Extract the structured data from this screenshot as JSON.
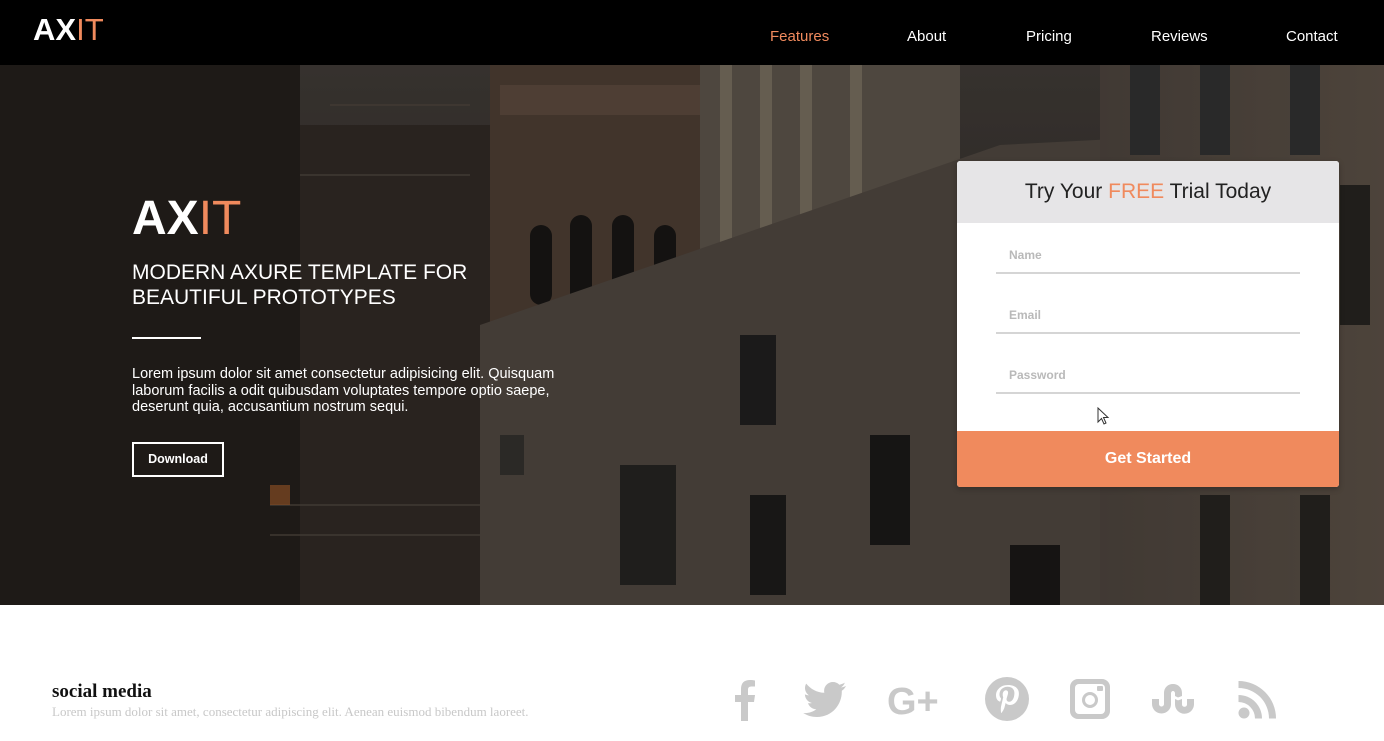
{
  "brand": {
    "logo_ax": "AX",
    "logo_it": "IT",
    "accent_color": "#f08a5d"
  },
  "nav": {
    "items": [
      {
        "label": "Features",
        "active": true
      },
      {
        "label": "About"
      },
      {
        "label": "Pricing"
      },
      {
        "label": "Reviews"
      },
      {
        "label": "Contact"
      }
    ]
  },
  "hero": {
    "logo_ax": "AX",
    "logo_it": "IT",
    "heading": "MODERN AXURE TEMPLATE FOR BEAUTIFUL PROTOTYPES",
    "description": "Lorem ipsum dolor sit amet consectetur adipisicing elit. Quisquam laborum facilis a odit quibusdam voluptates tempore optio saepe, deserunt quia, accusantium nostrum sequi.",
    "download_label": "Download"
  },
  "signup": {
    "title_pre": "Try Your ",
    "title_highlight": "FREE",
    "title_post": " Trial Today",
    "name_placeholder": "Name",
    "email_placeholder": "Email",
    "password_placeholder": "Password",
    "submit_label": "Get Started"
  },
  "footer": {
    "title": "social media",
    "text": "Lorem ipsum dolor sit amet, consectetur adipiscing elit. Aenean euismod bibendum laoreet.",
    "icons": [
      "facebook-icon",
      "twitter-icon",
      "google-plus-icon",
      "pinterest-icon",
      "instagram-icon",
      "stumbleupon-icon",
      "rss-icon"
    ],
    "icon_color": "#c9c9c9",
    "gplus_text": "G+"
  }
}
